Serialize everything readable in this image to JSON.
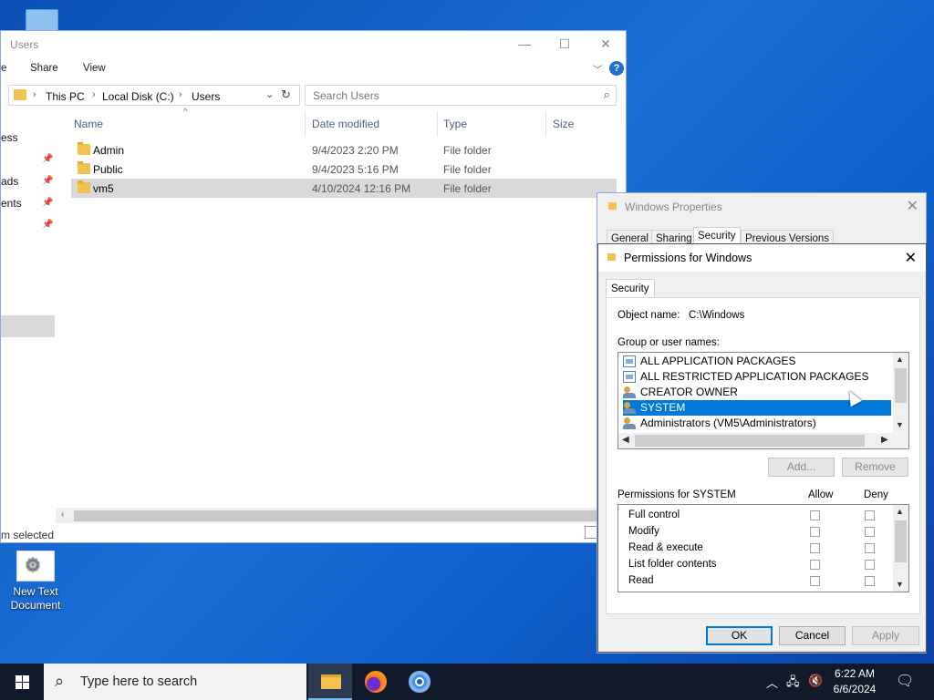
{
  "colors": {
    "accent": "#0078d7",
    "taskbar": "#101a2b",
    "folder": "#f3c24e",
    "desktop": "#1a6fd6"
  },
  "desktop": {
    "icons": [
      {
        "label": "New Text Document",
        "icon": "text-document-icon"
      }
    ]
  },
  "explorer": {
    "title": "Users",
    "ribbon_tabs": [
      "Share",
      "View"
    ],
    "breadcrumb": [
      "This PC",
      "Local Disk (C:)",
      "Users"
    ],
    "search_placeholder": "Search Users",
    "columns": [
      "Name",
      "Date modified",
      "Type",
      "Size"
    ],
    "rows": [
      {
        "name": "Admin",
        "date": "9/4/2023 2:20 PM",
        "type": "File folder",
        "selected": false
      },
      {
        "name": "Public",
        "date": "9/4/2023 5:16 PM",
        "type": "File folder",
        "selected": false
      },
      {
        "name": "vm5",
        "date": "4/10/2024 12:16 PM",
        "type": "File folder",
        "selected": true
      }
    ],
    "nav_items": [
      "ess",
      "ads",
      "ents"
    ],
    "status": "m selected"
  },
  "properties": {
    "title": "Windows Properties",
    "tabs": [
      "General",
      "Sharing",
      "Security",
      "Previous Versions"
    ],
    "active_tab": "Security"
  },
  "permissions": {
    "title": "Permissions for Windows",
    "tab": "Security",
    "object_label": "Object name:",
    "object_value": "C:\\Windows",
    "group_label": "Group or user names:",
    "groups": [
      {
        "name": "ALL APPLICATION PACKAGES",
        "icon": "package-group-icon",
        "selected": false
      },
      {
        "name": "ALL RESTRICTED APPLICATION PACKAGES",
        "icon": "package-group-icon",
        "selected": false
      },
      {
        "name": "CREATOR OWNER",
        "icon": "user-group-icon",
        "selected": false
      },
      {
        "name": "SYSTEM",
        "icon": "user-group-icon",
        "selected": true
      },
      {
        "name": "Administrators (VM5\\Administrators)",
        "icon": "user-group-icon",
        "selected": false
      }
    ],
    "add_label": "Add...",
    "remove_label": "Remove",
    "perm_for_label": "Permissions for SYSTEM",
    "allow_label": "Allow",
    "deny_label": "Deny",
    "perms": [
      "Full control",
      "Modify",
      "Read & execute",
      "List folder contents",
      "Read"
    ],
    "ok_label": "OK",
    "cancel_label": "Cancel",
    "apply_label": "Apply"
  },
  "taskbar": {
    "search_placeholder": "Type here to search",
    "apps": [
      "file-explorer-icon",
      "firefox-icon",
      "chrome-icon"
    ],
    "time": "6:22 AM",
    "date": "6/6/2024"
  }
}
